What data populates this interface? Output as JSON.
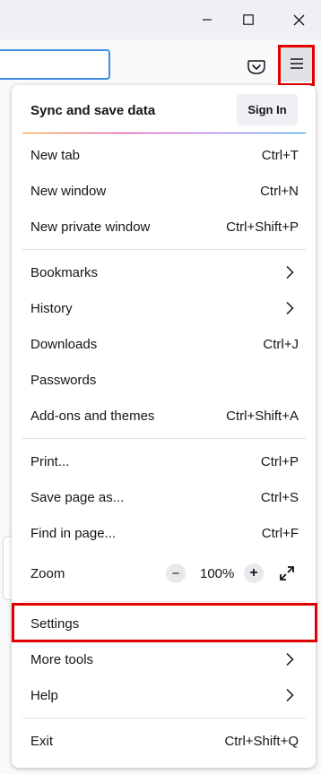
{
  "window_controls": {
    "minimize_icon": "minimize-icon",
    "maximize_icon": "maximize-icon",
    "close_icon": "close-icon"
  },
  "toolbar": {
    "pocket_icon": "pocket-icon",
    "menu_icon": "hamburger-menu-icon"
  },
  "menu": {
    "sync_label": "Sync and save data",
    "sign_in": "Sign In",
    "new_tab": {
      "label": "New tab",
      "shortcut": "Ctrl+T"
    },
    "new_window": {
      "label": "New window",
      "shortcut": "Ctrl+N"
    },
    "new_private_window": {
      "label": "New private window",
      "shortcut": "Ctrl+Shift+P"
    },
    "bookmarks": {
      "label": "Bookmarks"
    },
    "history": {
      "label": "History"
    },
    "downloads": {
      "label": "Downloads",
      "shortcut": "Ctrl+J"
    },
    "passwords": {
      "label": "Passwords"
    },
    "addons": {
      "label": "Add-ons and themes",
      "shortcut": "Ctrl+Shift+A"
    },
    "print": {
      "label": "Print...",
      "shortcut": "Ctrl+P"
    },
    "save_page": {
      "label": "Save page as...",
      "shortcut": "Ctrl+S"
    },
    "find": {
      "label": "Find in page...",
      "shortcut": "Ctrl+F"
    },
    "zoom": {
      "label": "Zoom",
      "minus": "−",
      "value": "100%",
      "plus": "+"
    },
    "settings": {
      "label": "Settings"
    },
    "more_tools": {
      "label": "More tools"
    },
    "help": {
      "label": "Help"
    },
    "exit": {
      "label": "Exit",
      "shortcut": "Ctrl+Shift+Q"
    }
  },
  "colors": {
    "highlight_border": "#e00000",
    "url_focus": "#3f8ce0"
  }
}
